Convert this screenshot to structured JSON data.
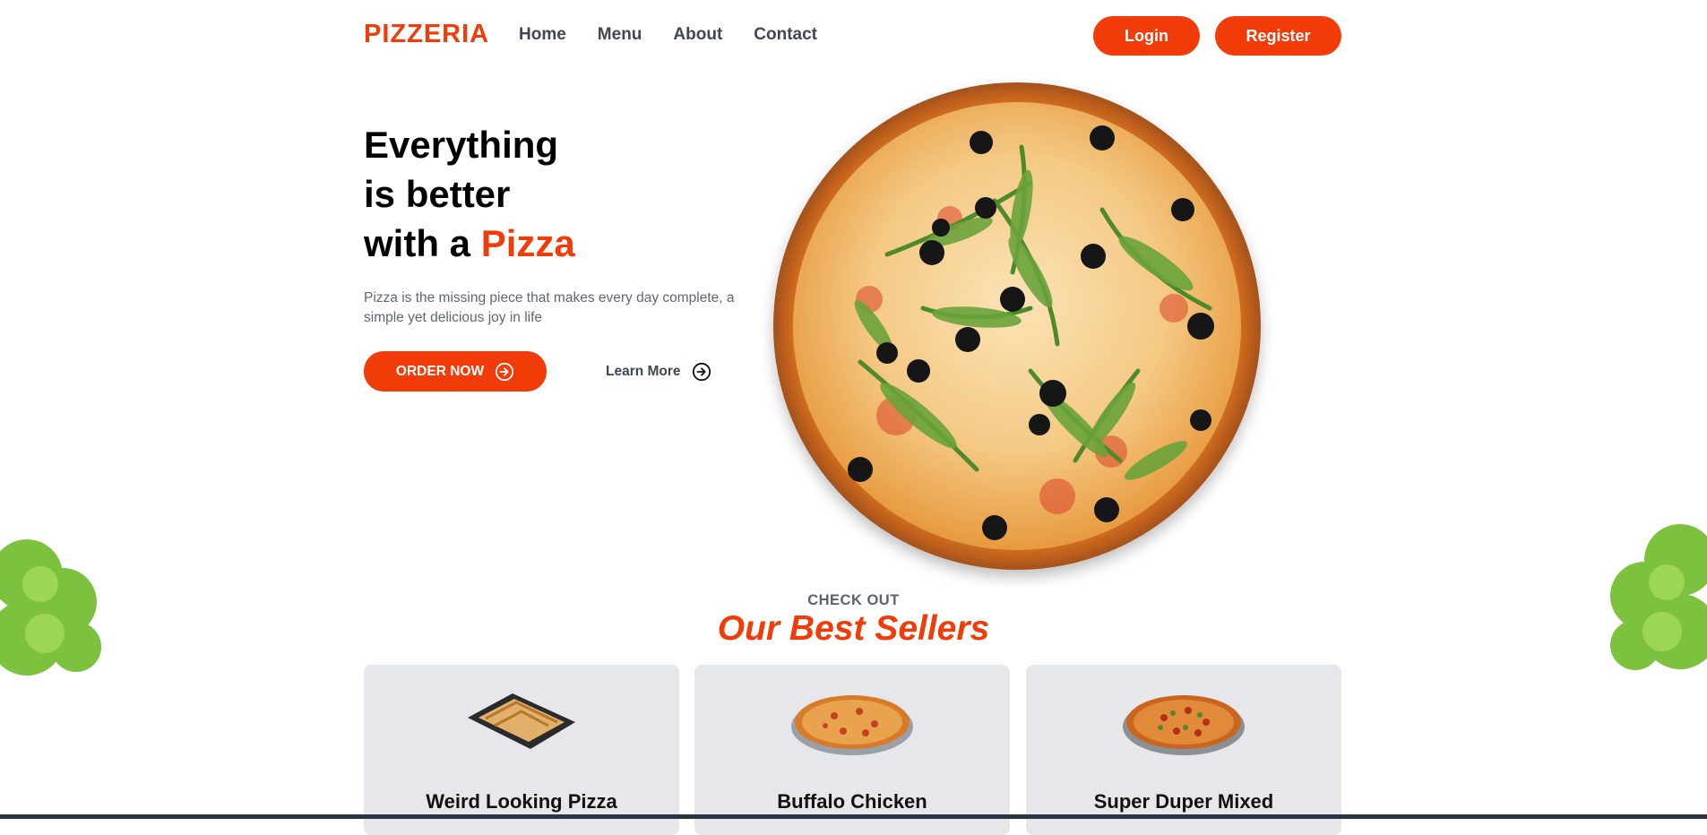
{
  "header": {
    "brand": "PIZZERIA",
    "nav": [
      "Home",
      "Menu",
      "About",
      "Contact"
    ],
    "login_label": "Login",
    "register_label": "Register"
  },
  "hero": {
    "title_line1": "Everything",
    "title_line2": "is better",
    "title_line3_prefix": "with a ",
    "title_accent": "Pizza",
    "description": "Pizza is the missing piece that makes every day complete, a simple yet delicious joy in life",
    "order_label": "ORDER NOW",
    "learn_label": "Learn More"
  },
  "best_sellers": {
    "kicker": "CHECK OUT",
    "title": "Our Best Sellers",
    "items": [
      {
        "name": "Weird Looking Pizza",
        "icon": "rectangular-pizza-image"
      },
      {
        "name": "Buffalo Chicken",
        "icon": "round-pizza-image"
      },
      {
        "name": "Super Duper Mixed",
        "icon": "round-pizza-image"
      }
    ]
  },
  "colors": {
    "accent": "#f13c0a",
    "nav_text": "#404753",
    "card_bg": "#e5e7ea"
  }
}
